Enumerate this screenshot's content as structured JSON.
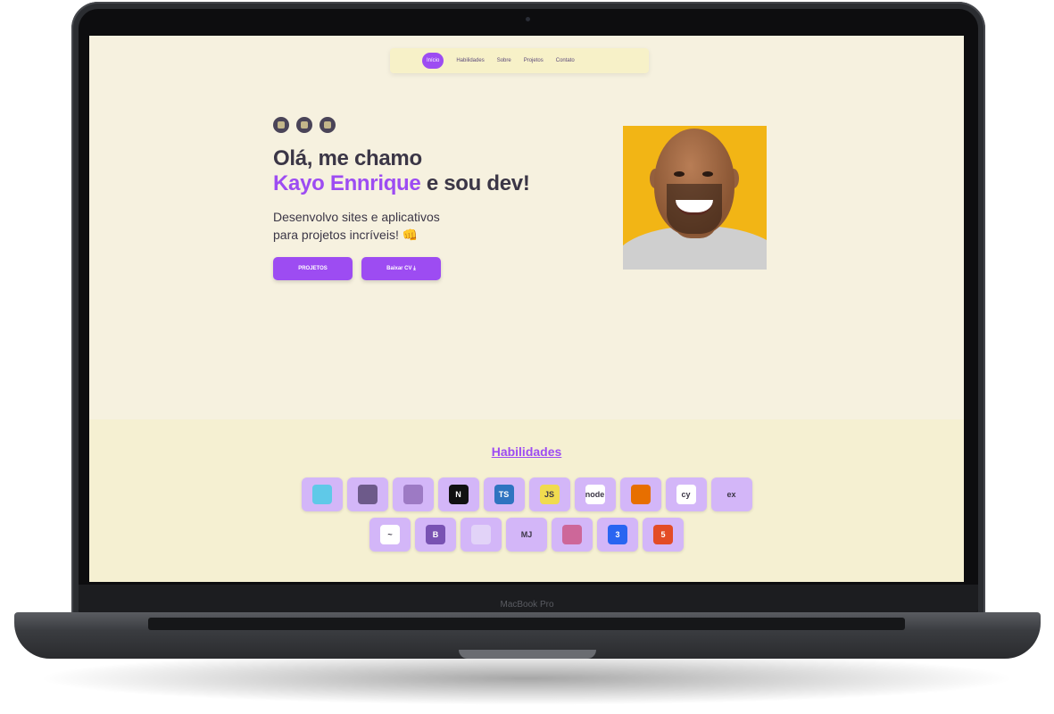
{
  "device": {
    "brand_label": "MacBook Pro"
  },
  "nav": {
    "items": [
      {
        "label": "Início",
        "active": true
      },
      {
        "label": "Habilidades",
        "active": false
      },
      {
        "label": "Sobre",
        "active": false
      },
      {
        "label": "Projetos",
        "active": false
      },
      {
        "label": "Contato",
        "active": false
      }
    ]
  },
  "hero": {
    "socials": [
      "github-icon",
      "linkedin-icon",
      "instagram-icon"
    ],
    "title_line1": "Olá, me chamo",
    "title_name": "Kayo Ennrique",
    "title_rest": " e sou dev!",
    "subtitle_line1": "Desenvolvo sites e aplicativos",
    "subtitle_line2": "para projetos incríveis! 👊",
    "button_projects": "PROJETOS",
    "button_cv": "Baixar CV ⤓",
    "accent_color": "#9d4cf2"
  },
  "skills": {
    "title": "Habilidades",
    "row1": [
      {
        "icon": "cube-icon",
        "text": "",
        "color": "#5fc9e8"
      },
      {
        "icon": "react-icon",
        "text": "",
        "color": "#6d5a8a"
      },
      {
        "icon": "redux-icon",
        "text": "",
        "color": "#9d7ac4"
      },
      {
        "icon": "nextjs-icon",
        "text": "N",
        "color": "#111111"
      },
      {
        "icon": "typescript-icon",
        "text": "TS",
        "color": "#2f74c0"
      },
      {
        "icon": "javascript-icon",
        "text": "JS",
        "color": "#f0db4f"
      },
      {
        "icon": "nodejs-icon",
        "text": "node",
        "color": "#ffffff"
      },
      {
        "icon": "java-icon",
        "text": "",
        "color": "#e76f00"
      },
      {
        "icon": "cypress-icon",
        "text": "cy",
        "color": "#ffffff"
      },
      {
        "icon": "express-icon",
        "text": "ex",
        "color": "#d3b6f8"
      }
    ],
    "row2": [
      {
        "icon": "tailwind-icon",
        "text": "~",
        "color": "#ffffff"
      },
      {
        "icon": "bootstrap-icon",
        "text": "B",
        "color": "#7952b3"
      },
      {
        "icon": "image-icon",
        "text": "",
        "color": "#e2d3f8"
      },
      {
        "icon": "mui-icon",
        "text": "MJ",
        "color": "#d3b6f8"
      },
      {
        "icon": "sass-icon",
        "text": "",
        "color": "#cd6799"
      },
      {
        "icon": "css3-icon",
        "text": "3",
        "color": "#2965f1"
      },
      {
        "icon": "html5-icon",
        "text": "5",
        "color": "#e34c26"
      }
    ]
  }
}
